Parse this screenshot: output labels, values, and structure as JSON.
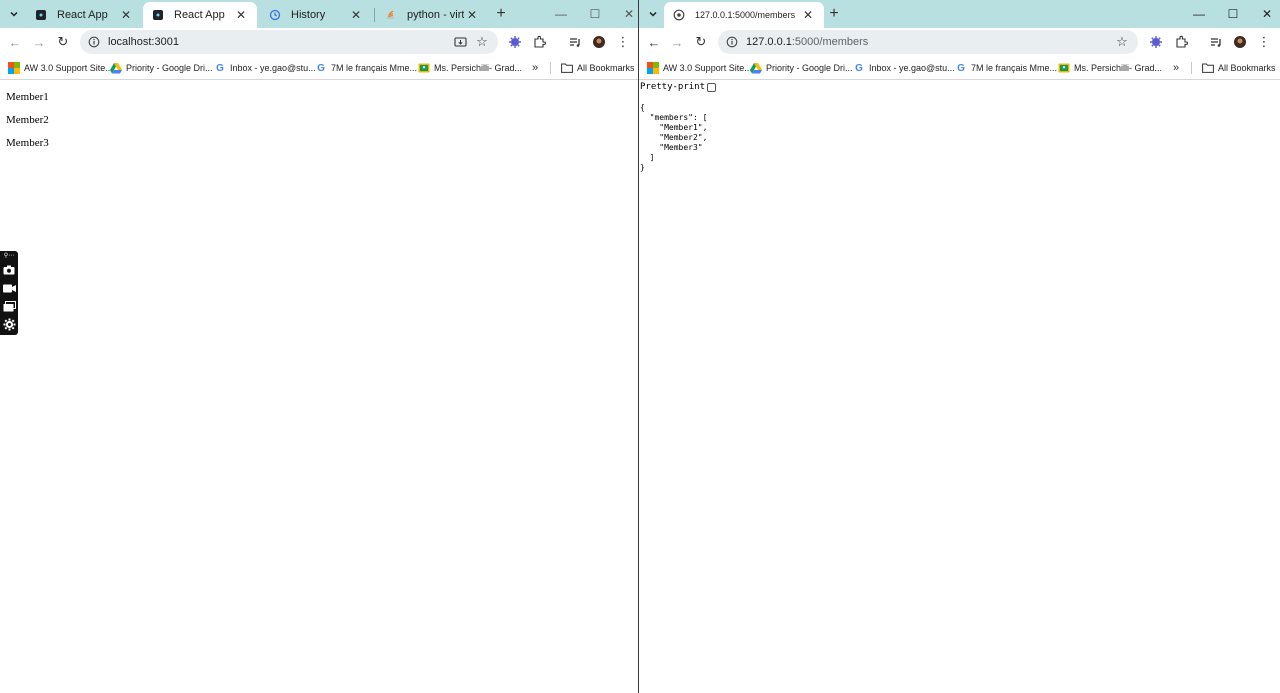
{
  "left_window": {
    "tabs": [
      {
        "label": "React App",
        "favicon": "react-icon",
        "active": false
      },
      {
        "label": "React App",
        "favicon": "react-icon",
        "active": true
      },
      {
        "label": "History",
        "favicon": "history-icon",
        "active": false
      },
      {
        "label": "python - virtualen",
        "favicon": "stackoverflow-icon",
        "active": false
      }
    ],
    "url": "localhost:3001",
    "bookmarks": [
      {
        "label": "AW 3.0 Support Site...",
        "icon": "aw-icon"
      },
      {
        "label": "Priority - Google Dri...",
        "icon": "google-drive-icon"
      },
      {
        "label": "Inbox - ye.gao@stu...",
        "icon": "google-icon"
      },
      {
        "label": "7M le français Mme...",
        "icon": "google-icon"
      },
      {
        "label": "Ms. Persichilli- Grad...",
        "icon": "classroom-icon"
      }
    ],
    "all_bookmarks": "All Bookmarks",
    "members": [
      "Member1",
      "Member2",
      "Member3"
    ]
  },
  "right_window": {
    "tab": {
      "label": "127.0.0.1:5000/members",
      "favicon": "globe-icon"
    },
    "url_host": "127.0.0.1",
    "url_path": ":5000/members",
    "bookmarks": [
      {
        "label": "AW 3.0 Support Site...",
        "icon": "aw-icon"
      },
      {
        "label": "Priority - Google Dri...",
        "icon": "google-drive-icon"
      },
      {
        "label": "Inbox - ye.gao@stu...",
        "icon": "google-icon"
      },
      {
        "label": "7M le français Mme...",
        "icon": "google-icon"
      },
      {
        "label": "Ms. Persichilli- Grad...",
        "icon": "classroom-icon"
      }
    ],
    "all_bookmarks": "All Bookmarks",
    "pretty_print_label": "Pretty-print",
    "json_text": "{\n  \"members\": [\n    \"Member1\",\n    \"Member2\",\n    \"Member3\"\n  ]\n}"
  },
  "colors": {
    "titlebar": "#b8e0e0",
    "omnibox": "#e9eef1",
    "accent_purple": "#5b5bd6"
  }
}
